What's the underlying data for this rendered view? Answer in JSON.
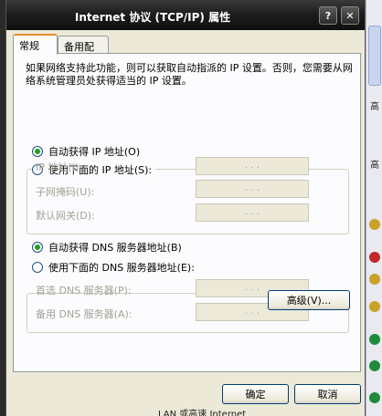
{
  "window": {
    "title": "Internet 协议 (TCP/IP) 属性",
    "help_label": "?",
    "close_label": "✕"
  },
  "tabs": [
    {
      "label": "常规",
      "active": true
    },
    {
      "label": "备用配置",
      "active": false
    }
  ],
  "description": "如果网络支持此功能，则可以获取自动指派的 IP 设置。否则，您需要从网络系统管理员处获得适当的 IP 设置。",
  "ip": {
    "auto_label": "自动获得 IP 地址(O)",
    "auto_selected": true,
    "manual_label": "使用下面的 IP 地址(S):",
    "manual_selected": false,
    "fields": [
      {
        "label": "IP 地址(I):",
        "value": ". . ."
      },
      {
        "label": "子网掩码(U):",
        "value": ". . ."
      },
      {
        "label": "默认网关(D):",
        "value": ". . ."
      }
    ]
  },
  "dns": {
    "auto_label": "自动获得 DNS 服务器地址(B)",
    "auto_selected": true,
    "manual_label": "使用下面的 DNS 服务器地址(E):",
    "manual_selected": false,
    "fields": [
      {
        "label": "首选 DNS 服务器(P):",
        "value": ". . ."
      },
      {
        "label": "备用 DNS 服务器(A):",
        "value": ". . ."
      }
    ]
  },
  "buttons": {
    "advanced": "高级(V)...",
    "ok": "确定",
    "cancel": "取消"
  },
  "background": {
    "peek_text": "LAN 或高速 Internet",
    "glyphs": [
      "高",
      "高"
    ]
  },
  "colors": {
    "title_bar": "#1e1e1e",
    "dialog_face": "#ece9d8",
    "radio_dot": "#21a121",
    "tab_highlight": "#e68b2c"
  }
}
